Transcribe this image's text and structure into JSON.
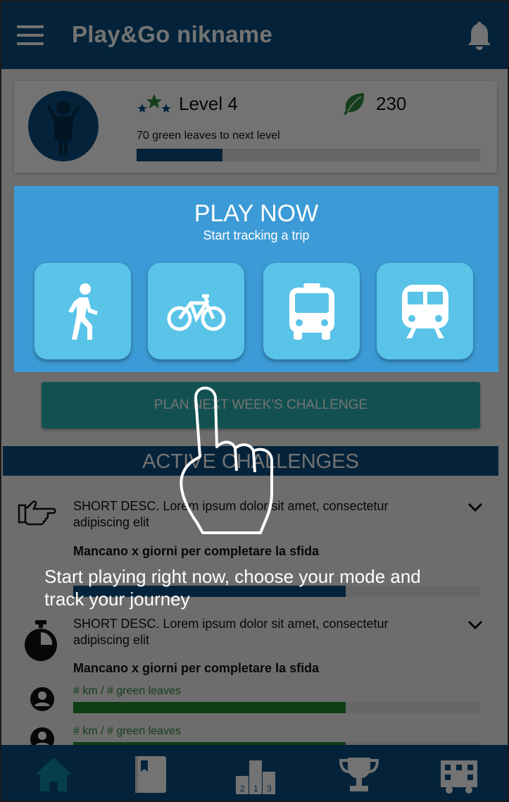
{
  "header": {
    "title": "Play&Go nikname",
    "menu_icon": "hamburger-menu-icon",
    "notification_icon": "bell-icon"
  },
  "profile": {
    "avatar_icon": "person-icon",
    "stars_icon": "stars-icon",
    "level": "Level 4",
    "leaf_icon": "leaf-icon",
    "points": "230",
    "next_level_text": "70 green leaves to next level",
    "level_progress": 0.25
  },
  "play_now": {
    "title": "PLAY NOW",
    "subtitle": "Start tracking a trip",
    "modes": [
      {
        "icon": "walk-icon"
      },
      {
        "icon": "bike-icon"
      },
      {
        "icon": "bus-icon"
      },
      {
        "icon": "train-icon"
      }
    ]
  },
  "plan_button": {
    "label": "PLAN NEXT WEEK'S CHALLENGE"
  },
  "active_challenges": {
    "title": "ACTIVE CHALLENGES",
    "items": [
      {
        "icon": "pointing-hand-icon",
        "description": "SHORT DESC. Lorem ipsum dolor sit amet, consectetur adipiscing elit",
        "remaining": "Mancano x giorni per completare la sfida",
        "progress": 0.67
      },
      {
        "icon": "stopwatch-icon",
        "description": "SHORT DESC. Lorem ipsum dolor sit amet, consectetur adipiscing elit",
        "remaining": "Mancano x giorni per completare la sfida",
        "rows": [
          {
            "metric": "# km / # green leaves",
            "progress": 0.67
          },
          {
            "metric": "# km / # green leaves",
            "progress": 0.67
          }
        ]
      }
    ]
  },
  "bottom_nav": [
    {
      "icon": "home-icon",
      "active": true
    },
    {
      "icon": "diary-icon",
      "active": false
    },
    {
      "icon": "podium-icon",
      "active": false
    },
    {
      "icon": "trophy-icon",
      "active": false
    },
    {
      "icon": "city-icon",
      "active": false
    }
  ],
  "tutorial": {
    "text": "Start playing right now, choose your mode and track your journey",
    "hand_icon": "tap-hand-icon"
  },
  "colors": {
    "primary": "#0b4f82",
    "play_panel": "#3c9bd6",
    "mode_button": "#5ac4e8",
    "plan_button": "#2bb3b3",
    "leaf_green": "#2e8b3e",
    "bar_green": "#1f8a2e"
  }
}
